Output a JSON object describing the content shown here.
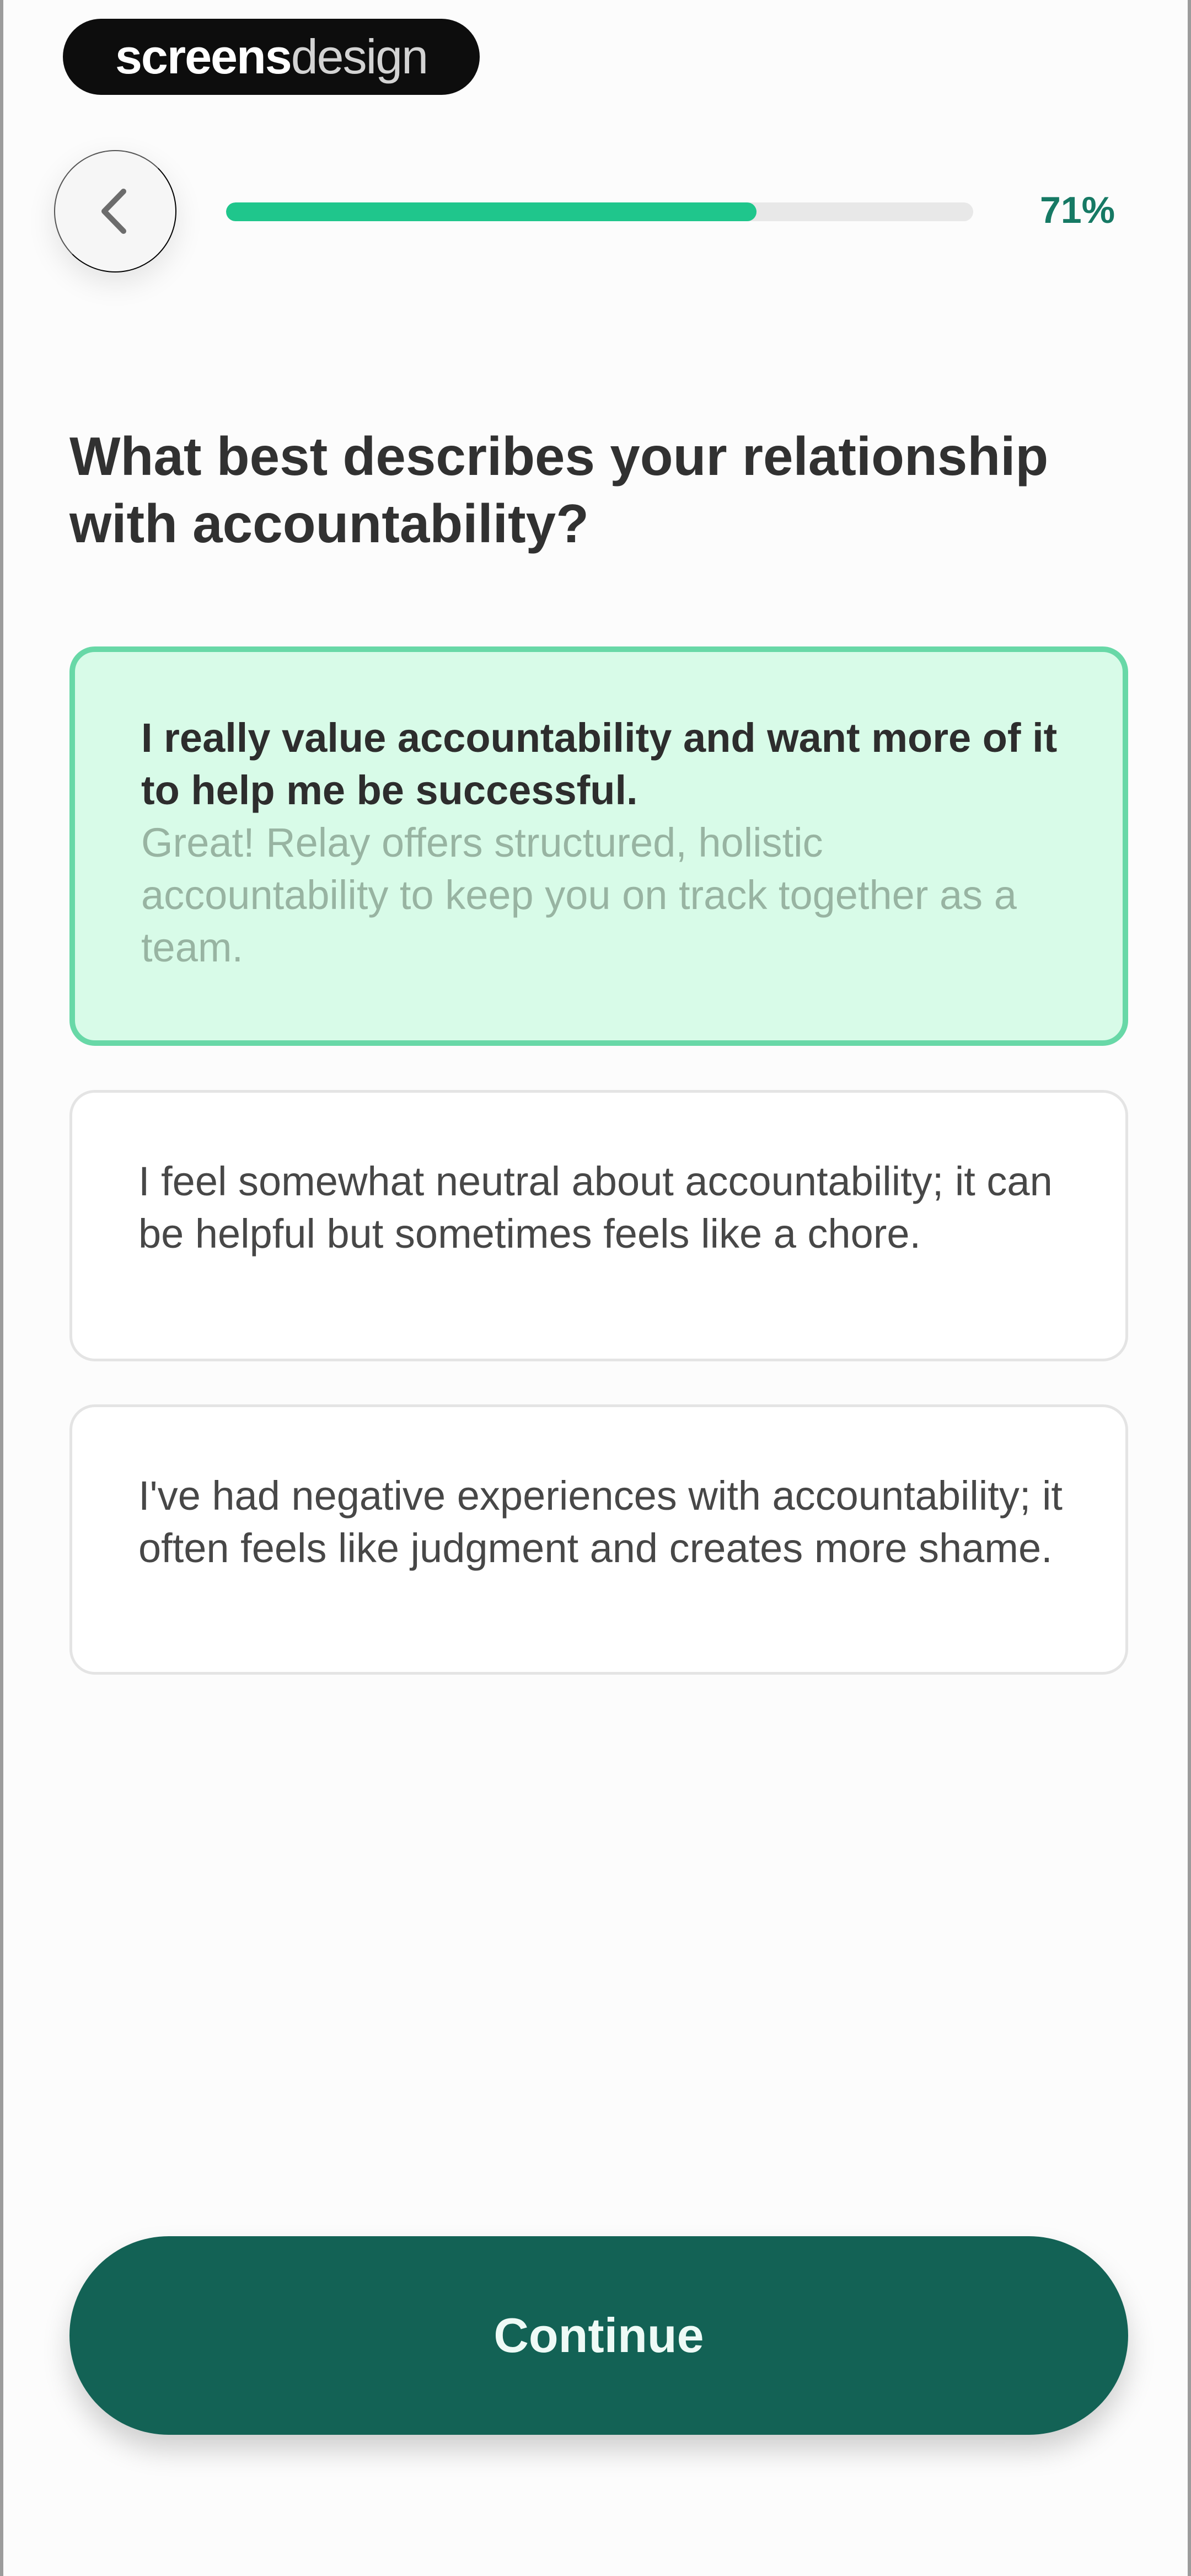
{
  "brand": {
    "strong": "screens",
    "light": "design"
  },
  "navigation": {
    "back_icon": "chevron-left-icon"
  },
  "progress": {
    "label": "71%",
    "value": 0.71,
    "fill_color": "#1fc68c",
    "track_color": "#e8e8e8",
    "label_color": "#167964"
  },
  "question": {
    "title": "What best describes your relationship with accountability?"
  },
  "options": [
    {
      "title": "I really value accountability and want more of it to help me be successful.",
      "note": "Great! Relay offers structured, holistic accountability to keep you on track together as a team.",
      "selected": true
    },
    {
      "title": "I feel somewhat neutral about accountability; it can be helpful but sometimes feels like a chore.",
      "selected": false
    },
    {
      "title": "I've had negative experiences with accountability; it often feels like judgment and creates more shame.",
      "selected": false
    }
  ],
  "colors": {
    "selected_background": "#d8fbe8",
    "selected_border": "#68d8a7",
    "button_background": "#136255"
  },
  "actions": {
    "continue_label": "Continue"
  }
}
